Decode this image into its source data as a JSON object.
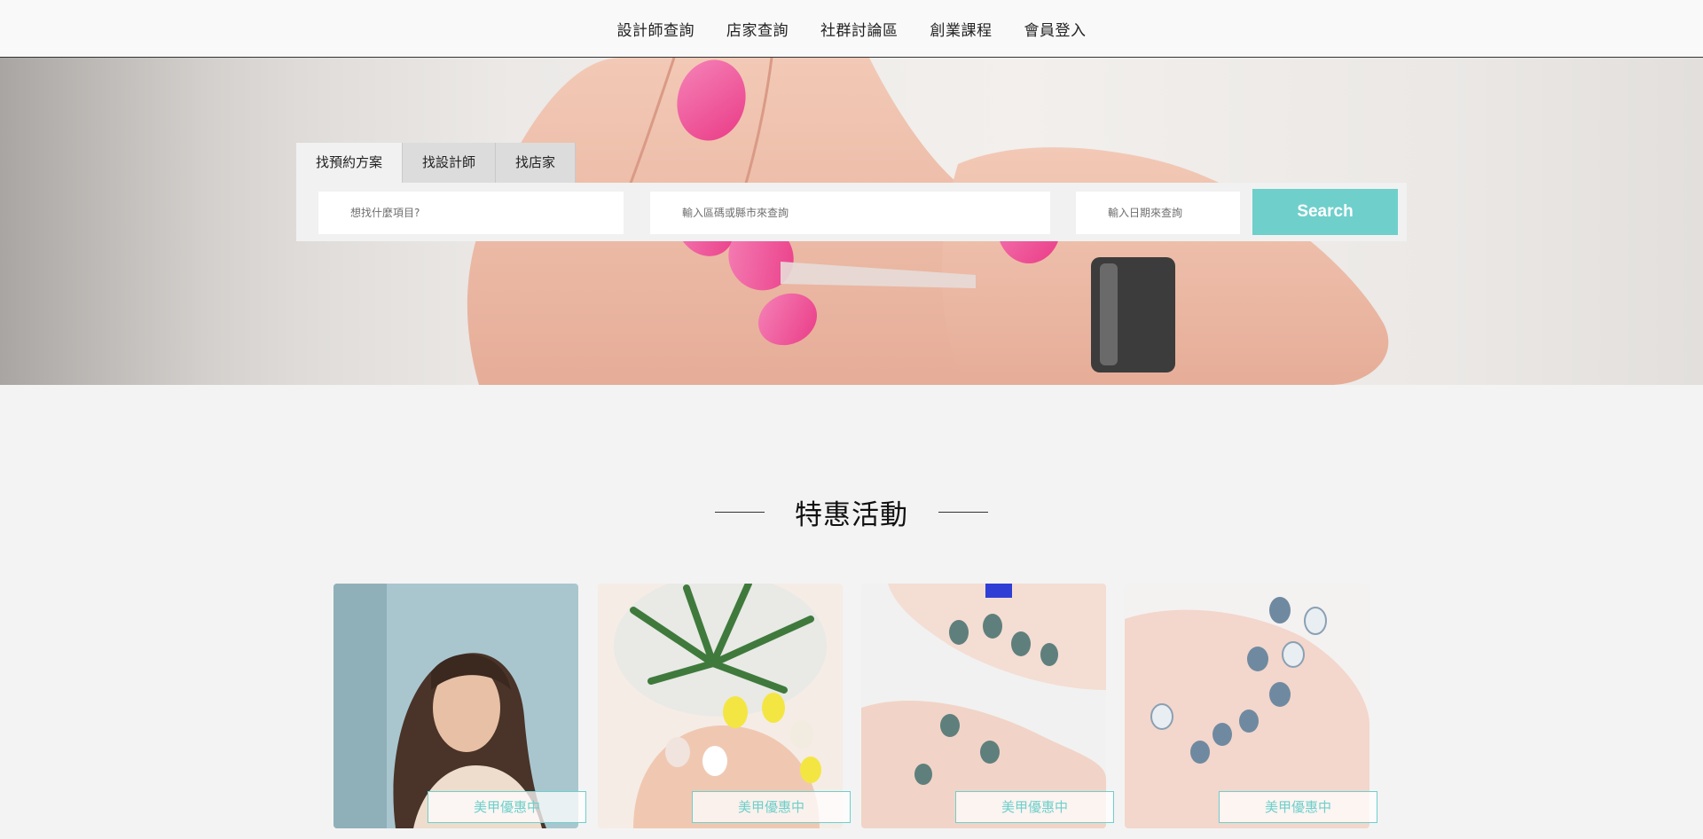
{
  "nav": {
    "items": [
      "設計師查詢",
      "店家查詢",
      "社群討論區",
      "創業課程",
      "會員登入"
    ]
  },
  "search": {
    "tabs": [
      "找預約方案",
      "找設計師",
      "找店家"
    ],
    "active_tab": "找預約方案",
    "what_placeholder": "想找什麼項目?",
    "area_placeholder": "輸入區碼或縣市來查詢",
    "date_placeholder": "輸入日期來查詢",
    "button_label": "Search"
  },
  "promotions": {
    "title": "特惠活動",
    "cards": [
      {
        "badge": "美甲優惠中"
      },
      {
        "badge": "美甲優惠中"
      },
      {
        "badge": "美甲優惠中"
      },
      {
        "badge": "美甲優惠中"
      }
    ]
  },
  "colors": {
    "accent": "#6fcfcb",
    "nail_pink": "#f0458c",
    "nail_slate": "#5f7f7d",
    "nail_gray_blue": "#6f8aa0",
    "nail_yellow": "#f4e642"
  }
}
